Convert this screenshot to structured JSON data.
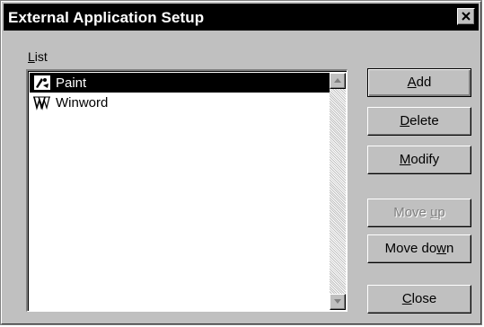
{
  "dialog": {
    "title": "External Application Setup",
    "close_icon": "close-x-icon"
  },
  "list": {
    "label_mnemonic": "L",
    "label_rest": "ist",
    "items": [
      {
        "label": "Paint",
        "icon": "paint-app-icon",
        "selected": true
      },
      {
        "label": "Winword",
        "icon": "winword-app-icon",
        "selected": false
      }
    ]
  },
  "buttons": {
    "add": {
      "mnemonic": "A",
      "rest": "dd"
    },
    "delete": {
      "mnemonic": "D",
      "rest": "elete"
    },
    "modify": {
      "mnemonic": "M",
      "rest": "odify"
    },
    "move_up": {
      "pre": "Move ",
      "mnemonic": "u",
      "rest": "p",
      "disabled": true
    },
    "move_down": {
      "pre": "Move do",
      "mnemonic": "w",
      "rest": "n"
    },
    "close": {
      "mnemonic": "C",
      "rest": "lose"
    }
  },
  "colors": {
    "face": "#c0c0c0",
    "titlebar": "#000000",
    "selection": "#000000",
    "disabled_text": "#808080"
  }
}
